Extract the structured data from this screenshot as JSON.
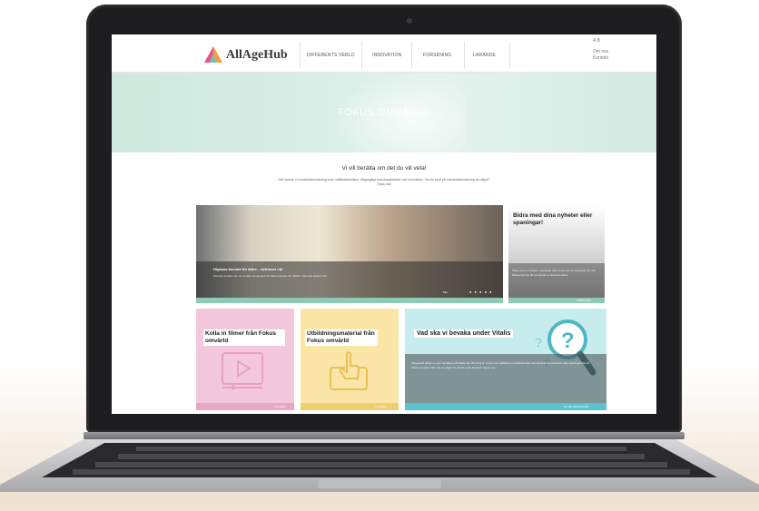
{
  "site": {
    "logo_text": "AllAgeHub",
    "nav": [
      "DIFFERENTS VERLD",
      "INNOVATION",
      "FORSKNING",
      "LARANDE"
    ],
    "language": "A  B",
    "utility_links": [
      "Om oss",
      "Kontakt"
    ]
  },
  "hero": {
    "title": "FOKUS OMVÄRLD"
  },
  "intro": {
    "title": "Vi vill berätta om det du vill veta!",
    "text": "Här samlar vi omvärldsbevakning inom välfärdstekniken, tillgängliga kunskapsbanker och innovation. Var du bjud på omvärldsbevakning av något? Tipsa oss!"
  },
  "tiles": {
    "main": {
      "title": "Hiyasus boende för äldre – delrinner via",
      "text": "Här kan du läsa mer om smarta utmaningar för äldre boende och välfärd. Läs hela artikeln här.",
      "more": "Mer",
      "dots": "● ● ● ● ●"
    },
    "side": {
      "title": "Bidra med dina nyheter eller spaningar!",
      "text": "Tipsa oss om nyheter, spaningar eller annat som är intressant för oss. Skicka ditt tips till oss så kan vi dela det vidare.",
      "bar_label": "TIPSA OSS"
    },
    "pink": {
      "title": "Kolla in filmer från Fokus omvärld",
      "bar_label": "FILMER"
    },
    "yellow": {
      "title": "Utbildningsmaterial från Fokus omvärld",
      "bar_label": "LÄS MER"
    },
    "teal": {
      "title": "Vad ska vi bevaka under Vitalis",
      "text": "AllAgeHub deltar nu som besökare på Vitalis den 20-22 april. Vi kommer självklart omvärldsbevaka och planerar att publicera våra spaningar här på Fokus omvärld. Men har du något du vill att vi ska bevaka? Tipsa oss!",
      "bar_label": "SE DE SPANINGAR"
    }
  },
  "icons": [
    "laptop-camera-icon",
    "logo-icon",
    "video-play-icon",
    "pointing-hand-icon",
    "magnifier-question-icon"
  ],
  "colors": {
    "mint": "#cfe9df",
    "pink": "#f3c8dd",
    "yellow": "#fbe6a7",
    "teal": "#c7ecee",
    "accent": "#57c4cf"
  }
}
